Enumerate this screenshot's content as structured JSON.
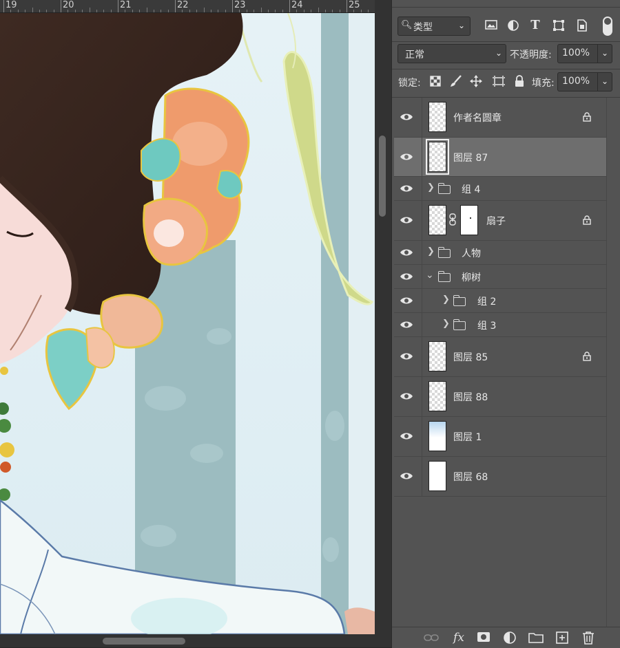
{
  "ruler": {
    "numbers": [
      "19",
      "20",
      "21",
      "22",
      "23",
      "24",
      "25"
    ]
  },
  "filter": {
    "kind_label": "类型",
    "icons": [
      "image-filter-icon",
      "adjustment-filter-icon",
      "text-filter-icon",
      "shape-filter-icon",
      "smartobject-filter-icon",
      "filter-toggle-icon"
    ]
  },
  "blend": {
    "mode": "正常",
    "opacity_label": "不透明度:",
    "opacity_value": "100%"
  },
  "lock": {
    "label": "锁定:",
    "fill_label": "填充:",
    "fill_value": "100%"
  },
  "layers": [
    {
      "name": "作者名圆章",
      "type": "layer",
      "locked": true,
      "selected": false
    },
    {
      "name": "图层 87",
      "type": "layer",
      "locked": false,
      "selected": true
    },
    {
      "name": "组 4",
      "type": "group",
      "expanded": false,
      "indent": 0
    },
    {
      "name": "扇子",
      "type": "masked-layer",
      "locked": true,
      "selected": false
    },
    {
      "name": "人物",
      "type": "group",
      "expanded": false,
      "indent": 0
    },
    {
      "name": "柳树",
      "type": "group",
      "expanded": true,
      "indent": 0
    },
    {
      "name": "组 2",
      "type": "group",
      "expanded": false,
      "indent": 1
    },
    {
      "name": "组 3",
      "type": "group",
      "expanded": false,
      "indent": 1
    },
    {
      "name": "图层 85",
      "type": "layer",
      "locked": true,
      "selected": false
    },
    {
      "name": "图层 88",
      "type": "layer",
      "locked": false,
      "selected": false
    },
    {
      "name": "图层 1",
      "type": "gradient-layer",
      "locked": false,
      "selected": false
    },
    {
      "name": "图层 68",
      "type": "white-layer",
      "locked": false,
      "selected": false
    }
  ],
  "bottom_icons": [
    "link-layers-icon",
    "fx-icon",
    "add-mask-icon",
    "adjustment-layer-icon",
    "new-group-icon",
    "new-layer-icon",
    "delete-layer-icon"
  ],
  "colors": {
    "panel_bg": "#535353",
    "selected_row": "#6e6e6e",
    "canvas_bg": "#e4f0f4"
  }
}
